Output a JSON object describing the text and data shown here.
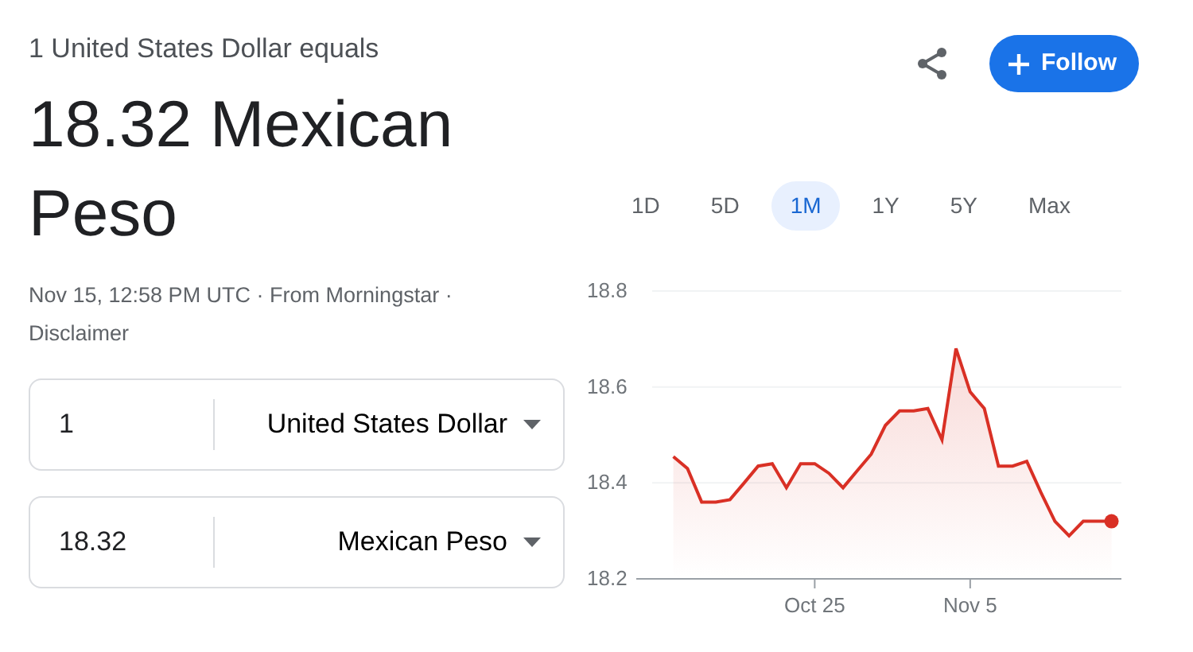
{
  "header": {
    "subtitle": "1 United States Dollar equals",
    "result": "18.32 Mexican Peso"
  },
  "follow_button": {
    "label": "Follow"
  },
  "meta": {
    "info": "Nov 15, 12:58 PM UTC · From Morningstar ·",
    "disclaimer": "Disclaimer"
  },
  "converter": [
    {
      "value": "1",
      "currency": "United States Dollar"
    },
    {
      "value": "18.32",
      "currency": "Mexican Peso"
    }
  ],
  "ranges": [
    {
      "label": "1D",
      "selected": false
    },
    {
      "label": "5D",
      "selected": false
    },
    {
      "label": "1M",
      "selected": true
    },
    {
      "label": "1Y",
      "selected": false
    },
    {
      "label": "5Y",
      "selected": false
    },
    {
      "label": "Max",
      "selected": false
    }
  ],
  "chart": {
    "chart_data": {
      "type": "area",
      "categories": [
        null,
        null,
        null,
        null,
        null,
        null,
        null,
        null,
        null,
        null,
        "Oct 25",
        null,
        null,
        null,
        null,
        null,
        null,
        null,
        null,
        null,
        null,
        "Nov 5",
        null,
        null,
        null,
        null,
        null,
        null,
        null,
        null,
        null,
        null
      ],
      "series": [
        {
          "color": "#d93025",
          "values": [
            18.455,
            18.43,
            18.36,
            18.36,
            18.365,
            18.4,
            18.435,
            18.44,
            18.39,
            18.44,
            18.44,
            18.42,
            18.39,
            18.425,
            18.46,
            18.52,
            18.55,
            18.55,
            18.555,
            18.49,
            18.68,
            18.59,
            18.555,
            18.435,
            18.435,
            18.445,
            18.38,
            18.32,
            18.29,
            18.32,
            18.32,
            18.32
          ]
        }
      ],
      "ylim": [
        18.2,
        18.8
      ],
      "yticks": [
        {
          "value": 18.2,
          "label": "18.2"
        },
        {
          "value": 18.4,
          "label": "18.4"
        },
        {
          "value": 18.6,
          "label": "18.6"
        },
        {
          "value": 18.8,
          "label": "18.8"
        }
      ]
    }
  }
}
